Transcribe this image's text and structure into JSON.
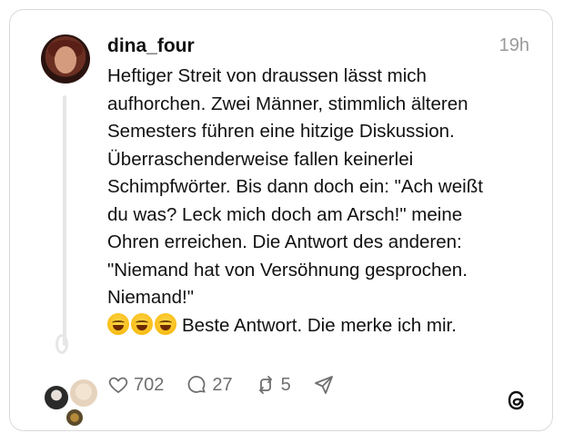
{
  "post": {
    "username": "dina_four",
    "time": "19h",
    "text": "Heftiger Streit von draussen lässt mich\naufhorchen. Zwei Männer, stimmlich älteren\nSemesters führen eine hitzige Diskussion.\nÜberraschenderweise fallen keinerlei\nSchimpfwörter. Bis dann doch ein: \"Ach weißt\ndu was? Leck mich doch am Arsch!\" meine\nOhren erreichen. Die Antwort des anderen:\n\"Niemand hat von Versöhnung gesprochen.\nNiemand!\"",
    "last_line": "Beste Antwort. Die merke ich mir.",
    "emoji": [
      "face-with-tears-of-joy",
      "face-with-tears-of-joy",
      "face-with-tears-of-joy"
    ]
  },
  "actions": {
    "likes": "702",
    "replies": "27",
    "reposts": "5"
  },
  "icons": [
    "heart-icon",
    "comment-icon",
    "repost-icon",
    "share-icon",
    "threads-logo-icon"
  ],
  "colors": {
    "text": "#111111",
    "muted": "#6f6f6f",
    "border": "#d9d9d9"
  }
}
